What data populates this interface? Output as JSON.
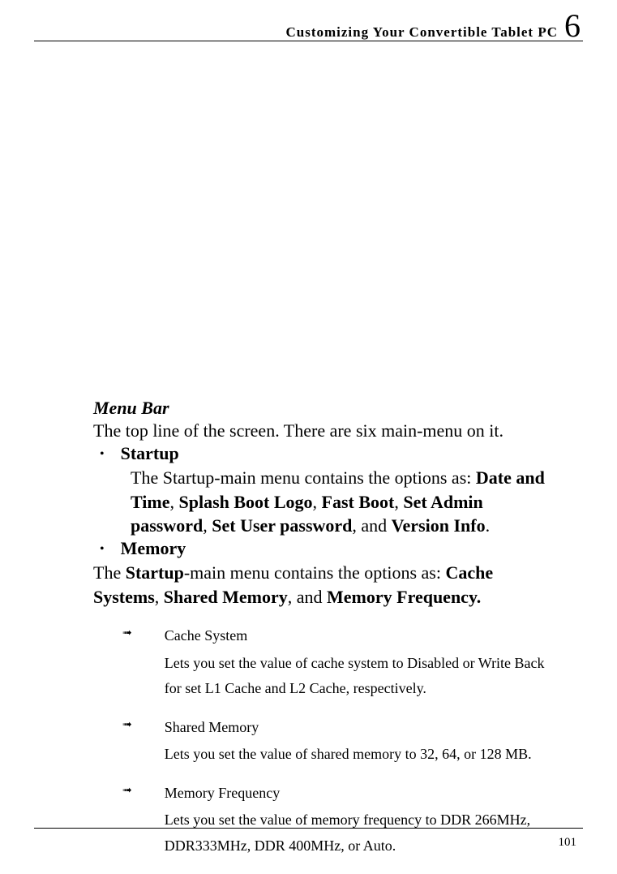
{
  "header": {
    "title": "Customizing Your Convertible Tablet PC",
    "chapter": "6"
  },
  "section": {
    "heading": "Menu Bar",
    "intro": "The top line of the screen. There are six main-menu on it."
  },
  "startup": {
    "label": "Startup",
    "desc_prefix": "The Startup-main menu contains the options as: ",
    "opt1": "Date and Time",
    "opt2": "Splash Boot Logo",
    "opt3": "Fast Boot",
    "opt4": "Set Admin password",
    "opt5": "Set User password",
    "opt6": "Version Info"
  },
  "memory": {
    "label": "Memory",
    "desc_prefix": "The ",
    "desc_bold1": "Startup",
    "desc_mid": "-main menu contains the options as: ",
    "opt1": "Cache Systems",
    "opt2": "Shared Memory",
    "opt3": "Memory Frequency."
  },
  "subs": {
    "cache": {
      "title": "Cache System",
      "desc": "Lets you set the value of cache system to Disabled or Write Back for set L1 Cache and L2 Cache, respectively."
    },
    "shared": {
      "title": "Shared Memory",
      "desc": "Lets you set the value of shared memory to 32, 64, or 128 MB."
    },
    "freq": {
      "title": "Memory Frequency",
      "desc": "Lets you set the value of memory frequency to DDR 266MHz, DDR333MHz, DDR 400MHz, or Auto."
    }
  },
  "page": "101"
}
